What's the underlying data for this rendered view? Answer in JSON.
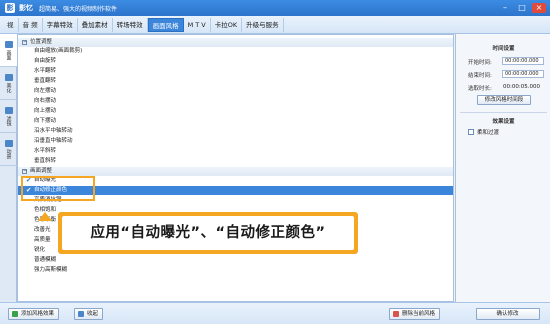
{
  "window": {
    "app_name": "影忆",
    "slogan": "超简易、强大的视频制作软件",
    "logo_glyph": "影"
  },
  "menu": [
    "视",
    "音  频",
    "字幕特效",
    "叠加素材",
    "转场特效",
    "画面风格",
    "M T V",
    "卡拉OK",
    "升级与服务"
  ],
  "menu_active_index": 5,
  "left_tabs": [
    "画面",
    "美化",
    "滤镜",
    "动景"
  ],
  "left_tab_active": 0,
  "groups": {
    "position": "位置调整",
    "picture": "画面调整"
  },
  "position_items": [
    "自由缩放(画面裁剪)",
    "自由旋转",
    "水平翻转",
    "垂直翻转",
    "向左摆动",
    "向右摆动",
    "向上摆动",
    "向下摆动",
    "沿水平中轴转动",
    "沿垂直中轴转动",
    "水平斜转",
    "垂直斜转"
  ],
  "picture_items": [
    {
      "label": "自动曝光",
      "checked": true,
      "selected": false
    },
    {
      "label": "自动修正颜色",
      "checked": true,
      "selected": true
    },
    {
      "label": "高质消抗锯",
      "checked": false,
      "selected": false
    },
    {
      "label": "色相饱和",
      "checked": false,
      "selected": false
    },
    {
      "label": "色彩平衡",
      "checked": false,
      "selected": false
    },
    {
      "label": "改善光",
      "checked": false,
      "selected": false
    },
    {
      "label": "高质量",
      "checked": false,
      "selected": false
    },
    {
      "label": "锐化",
      "checked": false,
      "selected": false
    },
    {
      "label": "普通模糊",
      "checked": false,
      "selected": false
    },
    {
      "label": "强力高斯模糊",
      "checked": false,
      "selected": false
    }
  ],
  "callout": {
    "text": "应用“自动曝光”、“自动修正颜色”"
  },
  "right_panel": {
    "time_title": "时间设置",
    "start_label": "开始时间:",
    "start_value": "00:00:00.000",
    "end_label": "结束时间:",
    "end_value": "00:00:00.000",
    "duration_label": "选取时长:",
    "duration_value": "00:00:05.000",
    "modify_time_button": "修改风格时间段",
    "effect_title": "效果设置",
    "soft_transition_label": "柔和过渡",
    "soft_transition_checked": false,
    "confirm_button": "确认修改"
  },
  "bottom": {
    "add_style": "添加风格效果",
    "collapse": "收起",
    "delete_style": "删除当前风格"
  },
  "colors": {
    "accent": "#3b86da",
    "highlight": "#f5a623"
  }
}
